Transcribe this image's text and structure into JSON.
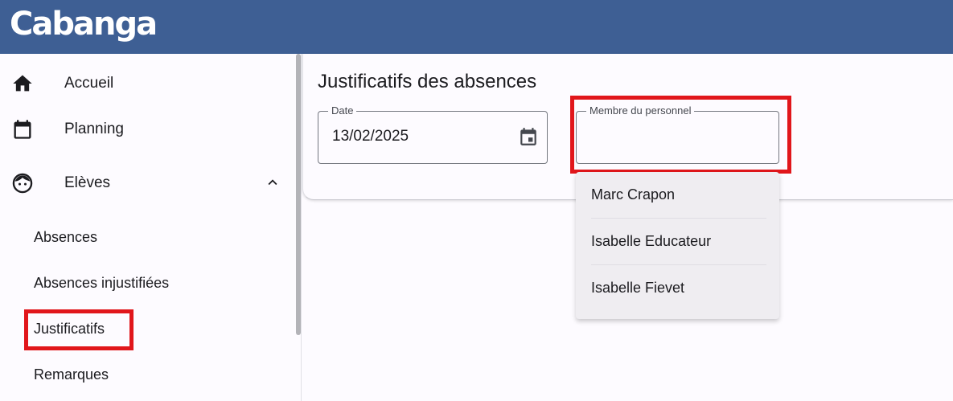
{
  "app": {
    "logo_text": "Cabanga"
  },
  "colors": {
    "header": "#3e5f94",
    "highlight": "#e1161b"
  },
  "sidebar": {
    "items": [
      {
        "label": "Accueil",
        "icon": "home-icon"
      },
      {
        "label": "Planning",
        "icon": "calendar-icon"
      },
      {
        "label": "Elèves",
        "icon": "child-face-icon",
        "expanded": true
      }
    ],
    "sub_items": [
      {
        "label": "Absences"
      },
      {
        "label": "Absences injustifiées"
      },
      {
        "label": "Justificatifs",
        "active": true
      },
      {
        "label": "Remarques"
      }
    ]
  },
  "main": {
    "title": "Justificatifs des absences",
    "date_field": {
      "label": "Date",
      "value": "13/02/2025"
    },
    "staff_field": {
      "label": "Membre du personnel",
      "value": ""
    },
    "staff_options": [
      "Marc Crapon",
      "Isabelle Educateur",
      "Isabelle Fievet"
    ]
  }
}
